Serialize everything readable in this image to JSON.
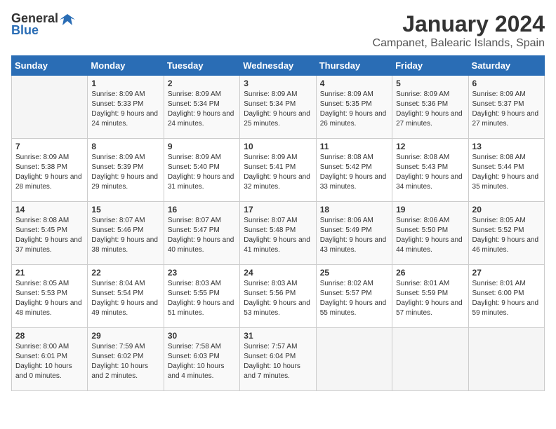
{
  "logo": {
    "general": "General",
    "blue": "Blue"
  },
  "title": "January 2024",
  "location": "Campanet, Balearic Islands, Spain",
  "weekdays": [
    "Sunday",
    "Monday",
    "Tuesday",
    "Wednesday",
    "Thursday",
    "Friday",
    "Saturday"
  ],
  "weeks": [
    [
      {
        "day": "",
        "sunrise": "",
        "sunset": "",
        "daylight": ""
      },
      {
        "day": "1",
        "sunrise": "Sunrise: 8:09 AM",
        "sunset": "Sunset: 5:33 PM",
        "daylight": "Daylight: 9 hours and 24 minutes."
      },
      {
        "day": "2",
        "sunrise": "Sunrise: 8:09 AM",
        "sunset": "Sunset: 5:34 PM",
        "daylight": "Daylight: 9 hours and 24 minutes."
      },
      {
        "day": "3",
        "sunrise": "Sunrise: 8:09 AM",
        "sunset": "Sunset: 5:34 PM",
        "daylight": "Daylight: 9 hours and 25 minutes."
      },
      {
        "day": "4",
        "sunrise": "Sunrise: 8:09 AM",
        "sunset": "Sunset: 5:35 PM",
        "daylight": "Daylight: 9 hours and 26 minutes."
      },
      {
        "day": "5",
        "sunrise": "Sunrise: 8:09 AM",
        "sunset": "Sunset: 5:36 PM",
        "daylight": "Daylight: 9 hours and 27 minutes."
      },
      {
        "day": "6",
        "sunrise": "Sunrise: 8:09 AM",
        "sunset": "Sunset: 5:37 PM",
        "daylight": "Daylight: 9 hours and 27 minutes."
      }
    ],
    [
      {
        "day": "7",
        "sunrise": "Sunrise: 8:09 AM",
        "sunset": "Sunset: 5:38 PM",
        "daylight": "Daylight: 9 hours and 28 minutes."
      },
      {
        "day": "8",
        "sunrise": "Sunrise: 8:09 AM",
        "sunset": "Sunset: 5:39 PM",
        "daylight": "Daylight: 9 hours and 29 minutes."
      },
      {
        "day": "9",
        "sunrise": "Sunrise: 8:09 AM",
        "sunset": "Sunset: 5:40 PM",
        "daylight": "Daylight: 9 hours and 31 minutes."
      },
      {
        "day": "10",
        "sunrise": "Sunrise: 8:09 AM",
        "sunset": "Sunset: 5:41 PM",
        "daylight": "Daylight: 9 hours and 32 minutes."
      },
      {
        "day": "11",
        "sunrise": "Sunrise: 8:08 AM",
        "sunset": "Sunset: 5:42 PM",
        "daylight": "Daylight: 9 hours and 33 minutes."
      },
      {
        "day": "12",
        "sunrise": "Sunrise: 8:08 AM",
        "sunset": "Sunset: 5:43 PM",
        "daylight": "Daylight: 9 hours and 34 minutes."
      },
      {
        "day": "13",
        "sunrise": "Sunrise: 8:08 AM",
        "sunset": "Sunset: 5:44 PM",
        "daylight": "Daylight: 9 hours and 35 minutes."
      }
    ],
    [
      {
        "day": "14",
        "sunrise": "Sunrise: 8:08 AM",
        "sunset": "Sunset: 5:45 PM",
        "daylight": "Daylight: 9 hours and 37 minutes."
      },
      {
        "day": "15",
        "sunrise": "Sunrise: 8:07 AM",
        "sunset": "Sunset: 5:46 PM",
        "daylight": "Daylight: 9 hours and 38 minutes."
      },
      {
        "day": "16",
        "sunrise": "Sunrise: 8:07 AM",
        "sunset": "Sunset: 5:47 PM",
        "daylight": "Daylight: 9 hours and 40 minutes."
      },
      {
        "day": "17",
        "sunrise": "Sunrise: 8:07 AM",
        "sunset": "Sunset: 5:48 PM",
        "daylight": "Daylight: 9 hours and 41 minutes."
      },
      {
        "day": "18",
        "sunrise": "Sunrise: 8:06 AM",
        "sunset": "Sunset: 5:49 PM",
        "daylight": "Daylight: 9 hours and 43 minutes."
      },
      {
        "day": "19",
        "sunrise": "Sunrise: 8:06 AM",
        "sunset": "Sunset: 5:50 PM",
        "daylight": "Daylight: 9 hours and 44 minutes."
      },
      {
        "day": "20",
        "sunrise": "Sunrise: 8:05 AM",
        "sunset": "Sunset: 5:52 PM",
        "daylight": "Daylight: 9 hours and 46 minutes."
      }
    ],
    [
      {
        "day": "21",
        "sunrise": "Sunrise: 8:05 AM",
        "sunset": "Sunset: 5:53 PM",
        "daylight": "Daylight: 9 hours and 48 minutes."
      },
      {
        "day": "22",
        "sunrise": "Sunrise: 8:04 AM",
        "sunset": "Sunset: 5:54 PM",
        "daylight": "Daylight: 9 hours and 49 minutes."
      },
      {
        "day": "23",
        "sunrise": "Sunrise: 8:03 AM",
        "sunset": "Sunset: 5:55 PM",
        "daylight": "Daylight: 9 hours and 51 minutes."
      },
      {
        "day": "24",
        "sunrise": "Sunrise: 8:03 AM",
        "sunset": "Sunset: 5:56 PM",
        "daylight": "Daylight: 9 hours and 53 minutes."
      },
      {
        "day": "25",
        "sunrise": "Sunrise: 8:02 AM",
        "sunset": "Sunset: 5:57 PM",
        "daylight": "Daylight: 9 hours and 55 minutes."
      },
      {
        "day": "26",
        "sunrise": "Sunrise: 8:01 AM",
        "sunset": "Sunset: 5:59 PM",
        "daylight": "Daylight: 9 hours and 57 minutes."
      },
      {
        "day": "27",
        "sunrise": "Sunrise: 8:01 AM",
        "sunset": "Sunset: 6:00 PM",
        "daylight": "Daylight: 9 hours and 59 minutes."
      }
    ],
    [
      {
        "day": "28",
        "sunrise": "Sunrise: 8:00 AM",
        "sunset": "Sunset: 6:01 PM",
        "daylight": "Daylight: 10 hours and 0 minutes."
      },
      {
        "day": "29",
        "sunrise": "Sunrise: 7:59 AM",
        "sunset": "Sunset: 6:02 PM",
        "daylight": "Daylight: 10 hours and 2 minutes."
      },
      {
        "day": "30",
        "sunrise": "Sunrise: 7:58 AM",
        "sunset": "Sunset: 6:03 PM",
        "daylight": "Daylight: 10 hours and 4 minutes."
      },
      {
        "day": "31",
        "sunrise": "Sunrise: 7:57 AM",
        "sunset": "Sunset: 6:04 PM",
        "daylight": "Daylight: 10 hours and 7 minutes."
      },
      {
        "day": "",
        "sunrise": "",
        "sunset": "",
        "daylight": ""
      },
      {
        "day": "",
        "sunrise": "",
        "sunset": "",
        "daylight": ""
      },
      {
        "day": "",
        "sunrise": "",
        "sunset": "",
        "daylight": ""
      }
    ]
  ]
}
